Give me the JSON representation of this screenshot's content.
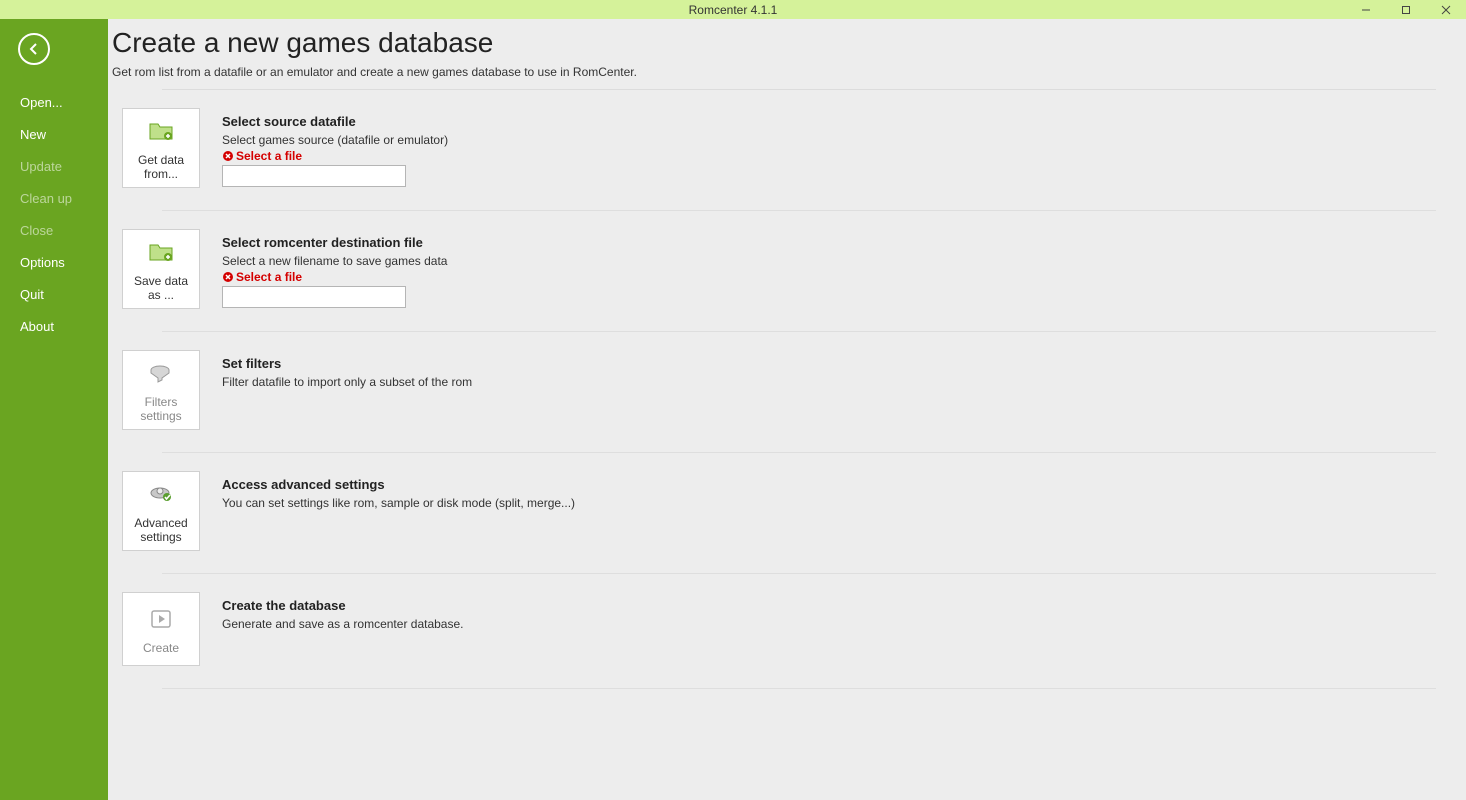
{
  "window": {
    "title": "Romcenter 4.1.1"
  },
  "sidebar": {
    "items": [
      {
        "label": "Open...",
        "enabled": true
      },
      {
        "label": "New",
        "enabled": true
      },
      {
        "label": "Update",
        "enabled": false
      },
      {
        "label": "Clean up",
        "enabled": false
      },
      {
        "label": "Close",
        "enabled": false
      },
      {
        "label": "Options",
        "enabled": true
      },
      {
        "label": "Quit",
        "enabled": true
      },
      {
        "label": "About",
        "enabled": true
      }
    ]
  },
  "page": {
    "title": "Create a new games database",
    "subtitle": "Get rom list from a datafile or an emulator and create a new games database to use in RomCenter."
  },
  "steps": {
    "source": {
      "button": "Get data from...",
      "title": "Select source datafile",
      "desc": "Select games source (datafile or emulator)",
      "error": "Select a file",
      "value": ""
    },
    "dest": {
      "button": "Save data as ...",
      "title": "Select romcenter destination file",
      "desc": "Select a new filename to save games data",
      "error": "Select a file",
      "value": ""
    },
    "filters": {
      "button": "Filters settings",
      "title": "Set filters",
      "desc": "Filter datafile to import only a subset of the rom"
    },
    "advanced": {
      "button": "Advanced settings",
      "title": "Access advanced settings",
      "desc": "You can set settings like rom, sample or disk mode (split, merge...)"
    },
    "create": {
      "button": "Create",
      "title": "Create the database",
      "desc": "Generate and save as a romcenter database."
    }
  }
}
